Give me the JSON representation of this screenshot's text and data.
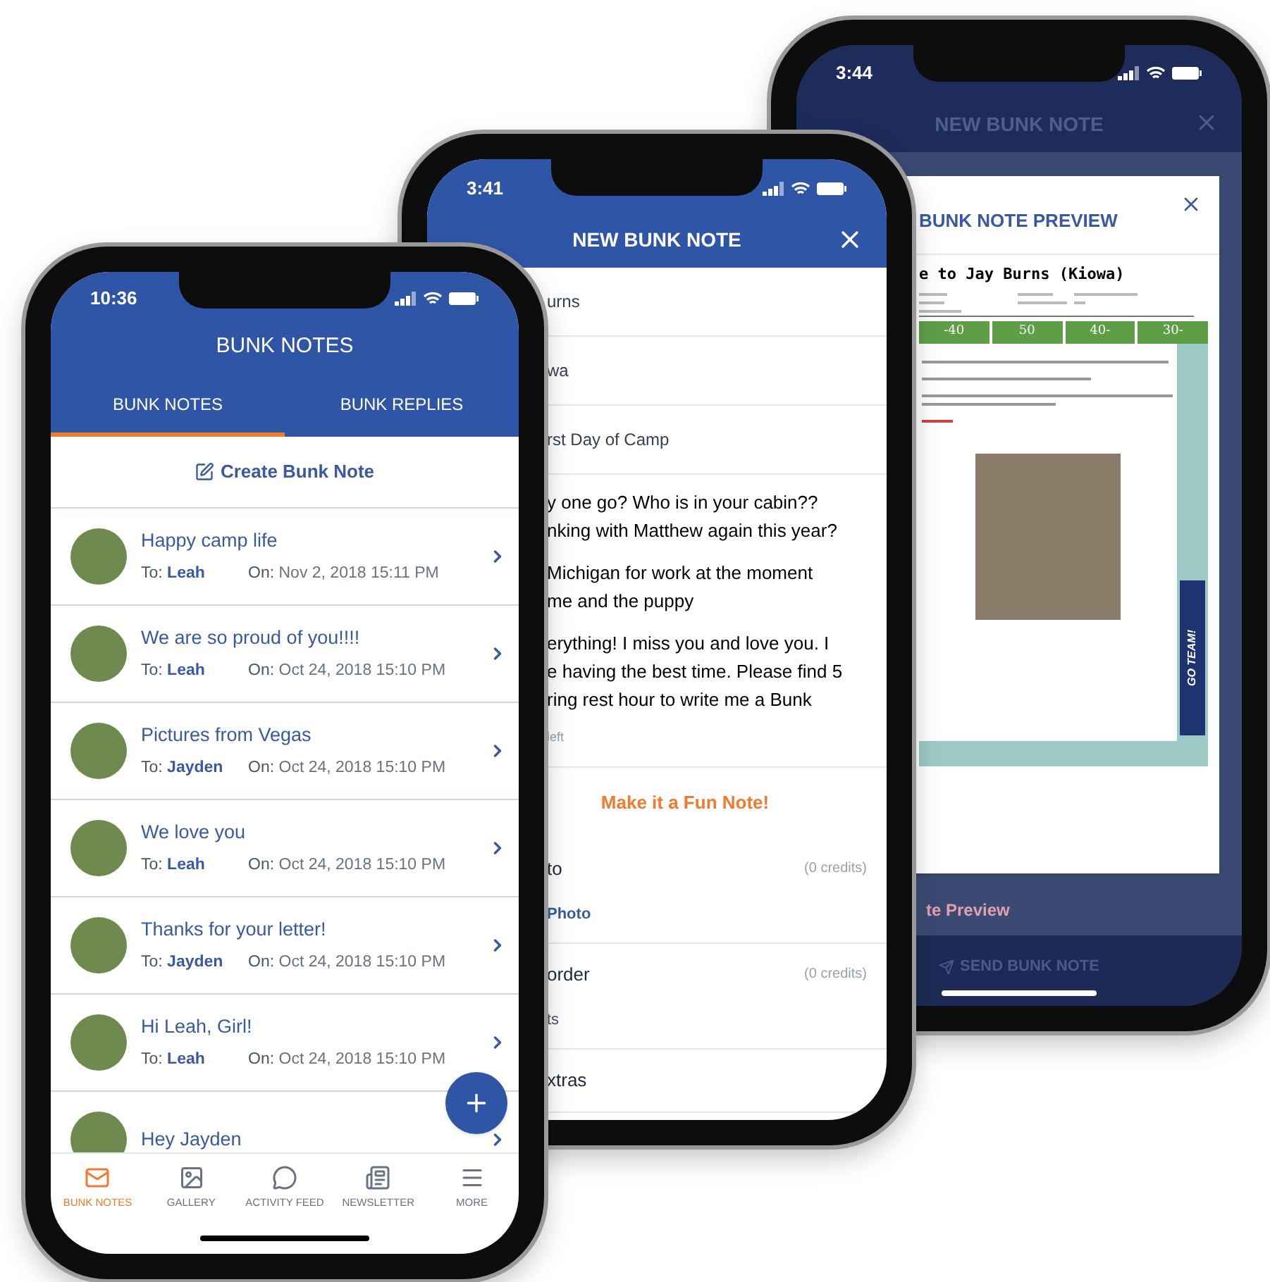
{
  "preview_screen": {
    "status_time": "3:44",
    "title": "NEW BUNK NOTE",
    "modal": {
      "title": "BUNK NOTE PREVIEW",
      "letter_heading": "e to Jay Burns (Kiowa)",
      "yard_markers": [
        "-40",
        "50",
        "40-",
        "30-"
      ],
      "banner": "GO TEAM!"
    },
    "link": "te Preview",
    "send_button": "SEND BUNK NOTE"
  },
  "new_note_screen": {
    "status_time": "3:41",
    "title": "NEW BUNK NOTE",
    "fields": [
      "urns",
      "wa",
      "rst Day of Camp"
    ],
    "message": [
      [
        "y one go? Who is in your cabin??",
        "nking with Matthew again this year?"
      ],
      [
        "Michigan for work at the moment",
        "me and the puppy"
      ],
      [
        "erything! I miss you and love you. I",
        "e having the best time. Please find 5",
        "ring rest hour to write me a Bunk"
      ]
    ],
    "counter": "left",
    "fun_note_button": "Make it a Fun Note!",
    "options": [
      {
        "label": "to",
        "credits": "(0 credits)",
        "action": "Photo"
      },
      {
        "label": "order",
        "credits": "(0 credits)",
        "action": "ts"
      },
      {
        "label": "xtras"
      }
    ]
  },
  "bunk_notes_screen": {
    "status_time": "10:36",
    "title": "BUNK NOTES",
    "tabs": [
      {
        "label": "BUNK NOTES",
        "selected": true
      },
      {
        "label": "BUNK REPLIES",
        "selected": false
      }
    ],
    "create_button": "Create Bunk Note",
    "notes": [
      {
        "title": "Happy camp life",
        "to_label": "To:",
        "recipient": "Leah",
        "date_label": "On:",
        "date": "Nov 2, 2018 15:11 PM"
      },
      {
        "title": "We are so proud of you!!!!",
        "to_label": "To:",
        "recipient": "Leah",
        "date_label": "On:",
        "date": "Oct 24, 2018 15:10 PM"
      },
      {
        "title": "Pictures from Vegas",
        "to_label": "To:",
        "recipient": "Jayden",
        "date_label": "On:",
        "date": "Oct 24, 2018 15:10 PM"
      },
      {
        "title": "We love you",
        "to_label": "To:",
        "recipient": "Leah",
        "date_label": "On:",
        "date": "Oct 24, 2018 15:10 PM"
      },
      {
        "title": "Thanks for your letter!",
        "to_label": "To:",
        "recipient": "Jayden",
        "date_label": "On:",
        "date": "Oct 24, 2018 15:10 PM"
      },
      {
        "title": "Hi Leah, Girl!",
        "to_label": "To:",
        "recipient": "Leah",
        "date_label": "On:",
        "date": "Oct 24, 2018 15:10 PM"
      },
      {
        "title": "Hey Jayden"
      }
    ],
    "nav": [
      {
        "label": "BUNK NOTES",
        "selected": true
      },
      {
        "label": "GALLERY",
        "selected": false
      },
      {
        "label": "ACTIVITY FEED",
        "selected": false
      },
      {
        "label": "NEWSLETTER",
        "selected": false
      },
      {
        "label": "MORE",
        "selected": false
      }
    ]
  }
}
